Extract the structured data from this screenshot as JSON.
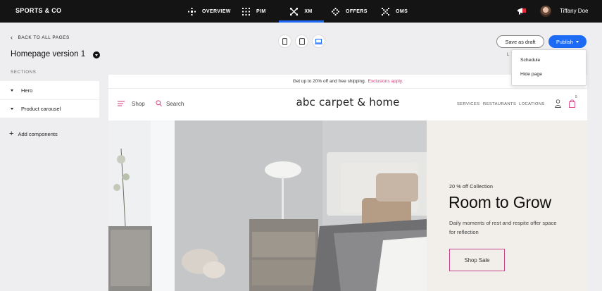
{
  "topbar": {
    "brand": "SPORTS & CO",
    "nav": [
      {
        "label": "OVERVIEW",
        "icon": "overview-icon"
      },
      {
        "label": "PIM",
        "icon": "grid-icon"
      },
      {
        "label": "XM",
        "icon": "xm-icon",
        "active": true
      },
      {
        "label": "OFFERS",
        "icon": "offers-icon"
      },
      {
        "label": "OMS",
        "icon": "oms-icon"
      }
    ],
    "user_name": "Tiffany Doe",
    "accent_color": "#1d6af5"
  },
  "sidebar": {
    "back_label": "BACK TO ALL PAGES",
    "page_title": "Homepage version 1",
    "sections_label": "SECTIONS",
    "sections": [
      {
        "label": "Hero"
      },
      {
        "label": "Product carousel"
      }
    ],
    "add_components": "Add components"
  },
  "toolbar": {
    "devices": [
      "mobile-icon",
      "tablet-icon",
      "desktop-icon"
    ],
    "active_device": "desktop",
    "save_draft": "Save as draft",
    "publish": "Publish",
    "publish_menu": [
      "Schedule",
      "Hide page"
    ],
    "partial_text": "L"
  },
  "preview": {
    "promo_text": "Get up to 20% off and free shipping.",
    "promo_link": "Exclusions apply.",
    "shop": "Shop",
    "search": "Search",
    "logo": "abc carpet & home",
    "nav_links": [
      "SERVICES",
      "RESTAURANTS",
      "LOCATIONS"
    ],
    "bag_count": "5",
    "hero": {
      "eyebrow": "20 % off Collection",
      "headline": "Room to Grow",
      "subtext": "Daily moments of rest and respite offer space for reflection",
      "cta": "Shop Sale"
    }
  }
}
